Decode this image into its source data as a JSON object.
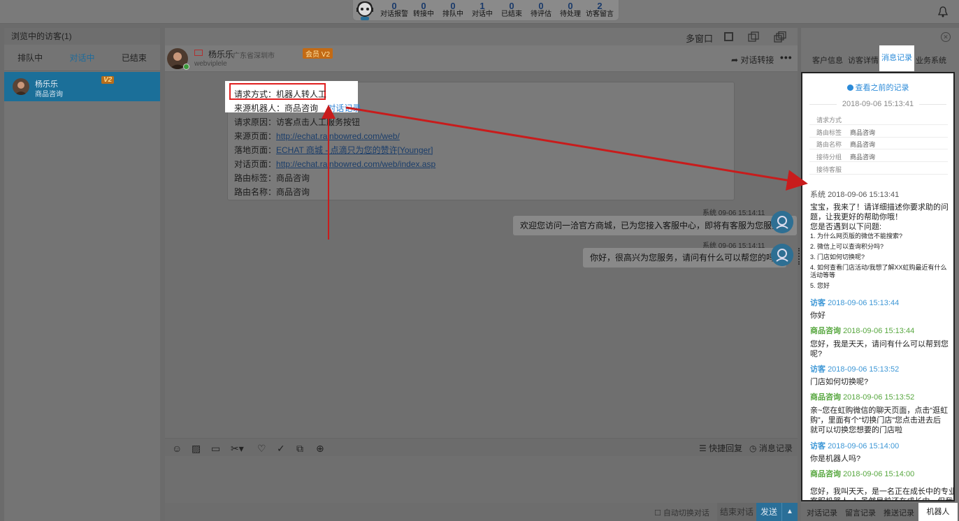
{
  "stats": [
    {
      "n": "0",
      "l": "对话报警"
    },
    {
      "n": "0",
      "l": "转接中"
    },
    {
      "n": "0",
      "l": "排队中"
    },
    {
      "n": "1",
      "l": "对话中"
    },
    {
      "n": "0",
      "l": "已结束"
    },
    {
      "n": "0",
      "l": "待评估"
    },
    {
      "n": "0",
      "l": "待处理"
    },
    {
      "n": "2",
      "l": "访客留言"
    }
  ],
  "left": {
    "header": "浏览中的访客(1)",
    "tabs": [
      "排队中",
      "对话中",
      "已结束"
    ],
    "visitor": {
      "name": "杨乐乐",
      "sub": "商品咨询",
      "badge": "V2"
    }
  },
  "mid": {
    "multiwindow": "多窗口",
    "chat": {
      "name": "杨乐乐",
      "location": "广东省深圳市",
      "vip": "会员 V2",
      "uid": "webviplele",
      "transfer": "对话转接",
      "more": "•••"
    },
    "info": {
      "r1": "请求方式：机器人转人工",
      "r2_label": "来源机器人：商品咨询",
      "r2_link": "对话记录",
      "r3": "请求原因：访客点击人工服务按钮",
      "r4_label": "来源页面：",
      "r4_link": "http://echat.rainbowred.com/web/",
      "r5_label": "落地页面：",
      "r5_link": "ECHAT 商城 - 点滴只为您的赞许[Younger]",
      "r6_label": "对话页面：",
      "r6_link": "http://echat.rainbowred.com/web/index.asp",
      "r7": "路由标签：商品咨询",
      "r8": "路由名称：商品咨询"
    },
    "messages": [
      {
        "meta": "系统 09-06 15:14:11",
        "text": "欢迎您访问一洽官方商城，已为您接入客服中心，即将有客服为您服务~~"
      },
      {
        "meta": "系统 09-06 15:14:11",
        "text": "你好，很高兴为您服务，请问有什么可以帮您的吗?"
      }
    ],
    "toolbar": {
      "quick": "快捷回复",
      "history": "消息记录"
    },
    "footer": {
      "auto": "自动切换对话",
      "end": "结束对话",
      "send": "发送"
    }
  },
  "right": {
    "tabs": [
      "客户信息",
      "访客详情",
      "消息记录",
      "业务系统"
    ],
    "prev": "查看之前的记录",
    "date": "2018-09-06 15:13:41",
    "kv": [
      {
        "k": "请求方式",
        "v": ""
      },
      {
        "k": "路由标签",
        "v": "商品咨询"
      },
      {
        "k": "路由名称",
        "v": "商品咨询"
      },
      {
        "k": "接待分组",
        "v": "商品咨询"
      },
      {
        "k": "接待客服",
        "v": ""
      }
    ],
    "log": {
      "sys_who": "系统",
      "sys_time": "2018-09-06 15:13:41",
      "sys_l1": "宝宝，我来了！请详细描述你要求助的问",
      "sys_l2": "题，让我更好的帮助你哦！",
      "sys_l3": "您是否遇到以下问题:",
      "q1": "1. 为什么网页版的微信不能搜索?",
      "q2": "2. 微信上可以查询积分吗?",
      "q3": "3. 门店如何切换呢?",
      "q4a": "4. 如何查看门店活动/我想了解XX虹购最近有什么",
      "q4b": "活动等等",
      "q5": "5. 您好",
      "e1_who": "访客",
      "e1_time": "2018-09-06 15:13:44",
      "e1_text": "你好",
      "e2_who": "商品咨询",
      "e2_time": "2018-09-06 15:13:44",
      "e2_l1": "您好，我是天天，请问有什么可以帮到您",
      "e2_l2": "呢?",
      "e3_who": "访客",
      "e3_time": "2018-09-06 15:13:52",
      "e3_text": "门店如何切换呢?",
      "e4_who": "商品咨询",
      "e4_time": "2018-09-06 15:13:52",
      "e4_l1": "亲~您在虹购微信的聊天页面，点击“逛虹",
      "e4_l2": "购”，里面有个“切换门店”您点击进去后",
      "e4_l3": "就可以切换您想要的门店啦",
      "e5_who": "访客",
      "e5_time": "2018-09-06 15:14:00",
      "e5_text": "你是机器人吗?",
      "e6_who": "商品咨询",
      "e6_time": "2018-09-06 15:14:00",
      "e6_l1": "您好，我叫天天，是一名正在成长中的专业",
      "e6_l2": "客服机器人~！虽然目前还在成长中，但我"
    },
    "footer": [
      "对话记录",
      "留言记录",
      "推送记录",
      "机器人"
    ]
  }
}
